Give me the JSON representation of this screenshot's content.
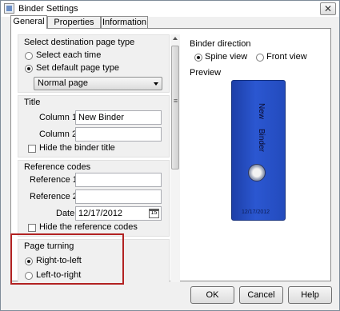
{
  "window": {
    "title": "Binder Settings",
    "close_glyph": "✕"
  },
  "tabs": [
    "General",
    "Properties",
    "Information"
  ],
  "destination": {
    "heading": "Select destination page type",
    "options": [
      "Select each time",
      "Set default page type"
    ],
    "selected_index": 1,
    "page_type_value": "Normal page"
  },
  "title_group": {
    "heading": "Title",
    "column1_label": "Column 1",
    "column1_value": "New Binder",
    "column2_label": "Column 2",
    "column2_value": "",
    "hide_label": "Hide the binder title",
    "hide_checked": false
  },
  "reference": {
    "heading": "Reference codes",
    "ref1_label": "Reference 1",
    "ref1_value": "",
    "ref2_label": "Reference 2",
    "ref2_value": "",
    "date_label": "Date",
    "date_value": "12/17/2012",
    "calendar_day": "15",
    "hide_label": "Hide the reference codes",
    "hide_checked": false
  },
  "page_turning": {
    "heading": "Page turning",
    "options": [
      "Right-to-left",
      "Left-to-right"
    ],
    "selected_index": 0
  },
  "binder_direction": {
    "heading": "Binder direction",
    "options": [
      "Spine view",
      "Front view"
    ],
    "selected_index": 0
  },
  "preview": {
    "heading": "Preview",
    "spine_title_line1": "New",
    "spine_title_line2": "Binder",
    "spine_date": "12/17/2012",
    "spine_color": "#2b57d1"
  },
  "buttons": {
    "ok": "OK",
    "cancel": "Cancel",
    "help": "Help"
  }
}
